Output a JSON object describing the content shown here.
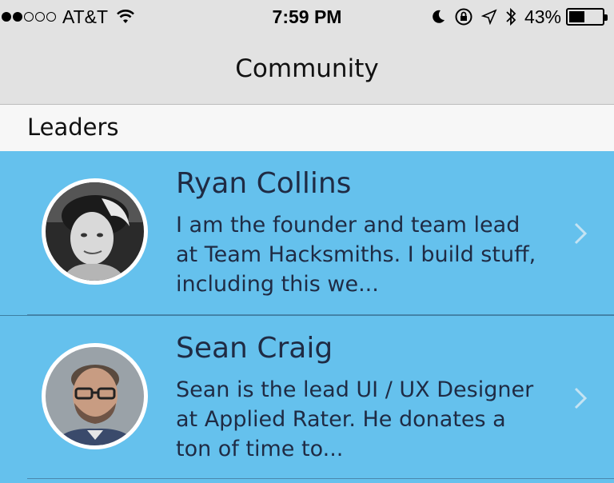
{
  "status_bar": {
    "carrier": "AT&T",
    "time": "7:59 PM",
    "battery_percent": "43%",
    "signal_strength": 2,
    "signal_total": 5
  },
  "nav": {
    "title": "Community"
  },
  "section": {
    "title": "Leaders"
  },
  "leaders": [
    {
      "name": "Ryan Collins",
      "bio": "I am the founder and team lead at Team Hacksmiths.  I build stuff, including this we..."
    },
    {
      "name": "Sean Craig",
      "bio": "Sean is the lead UI / UX Designer at Applied Rater. He donates a ton of time to..."
    }
  ],
  "colors": {
    "list_background": "#65c1ed",
    "text_dark": "#1f2b44",
    "bar_background": "#e2e2e2"
  }
}
